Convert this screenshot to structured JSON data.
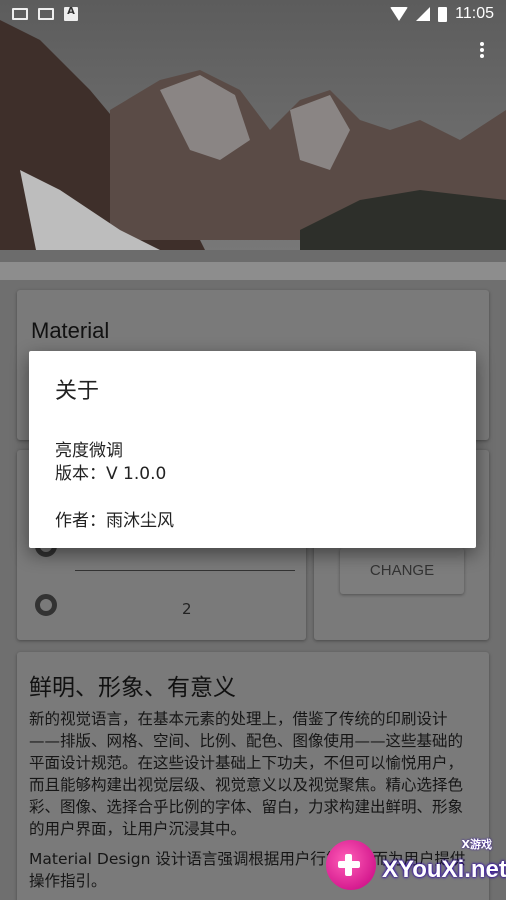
{
  "status_bar": {
    "time": "11:05"
  },
  "header": {
    "image": "mountain-lake-photo"
  },
  "cards": {
    "material_title": "Material",
    "slider_value": "2",
    "change_label": "CHANGE"
  },
  "article": {
    "title": "鲜明、形象、有意义",
    "paragraph1": "新的视觉语言，在基本元素的处理上，借鉴了传统的印刷设计——排版、网格、空间、比例、配色、图像使用——这些基础的平面设计规范。在这些设计基础上下功夫，不但可以愉悦用户，而且能够构建出视觉层级、视觉意义以及视觉聚焦。精心选择色彩、图像、选择合乎比例的字体、留白，力求构建出鲜明、形象的用户界面，让用户沉浸其中。",
    "paragraph2": "Material Design 设计语言强调根据用户行能，进而为用户提供操作指引。"
  },
  "dialog": {
    "title": "关于",
    "line1": "亮度微调",
    "line2": "版本：V 1.0.0",
    "line3": "作者：雨沐尘风"
  },
  "watermark": {
    "text": "XYouXi.net",
    "small": "X游戏"
  }
}
